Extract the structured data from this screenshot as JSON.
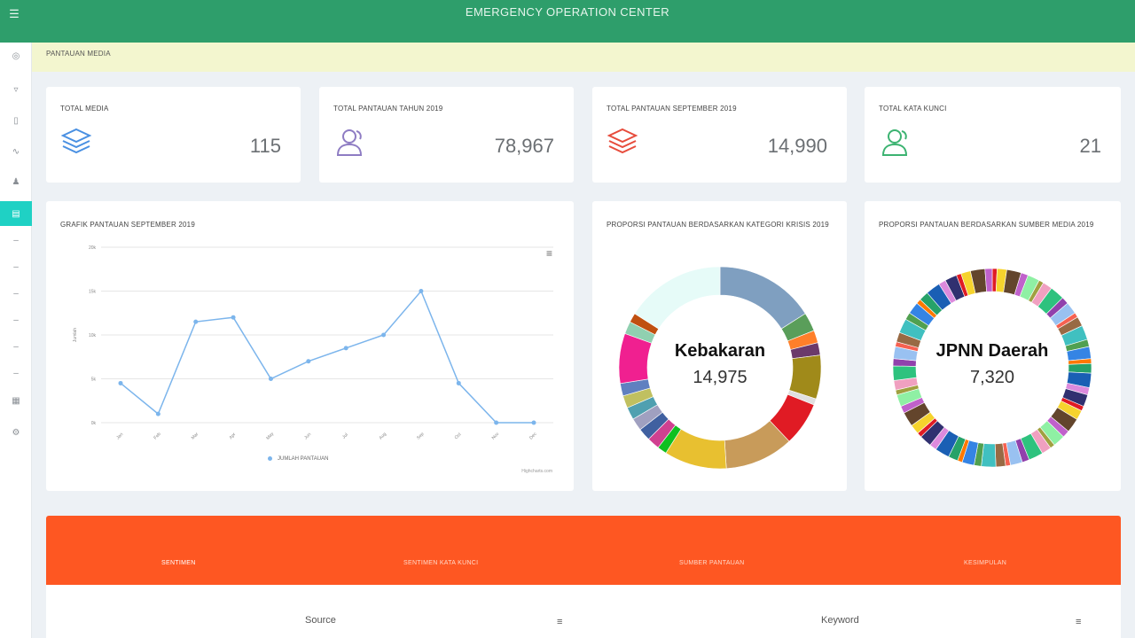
{
  "app": {
    "title": "EMERGENCY OPERATION CENTER"
  },
  "breadcrumb": {
    "text": "PANTAUAN MEDIA"
  },
  "icons": {
    "menu": "hamburger-icon",
    "sidebar": [
      "dashboard-icon",
      "filter-icon",
      "book-icon",
      "chart-icon",
      "user-icon",
      "media-icon",
      "dash-icon",
      "dash-icon",
      "dash-icon",
      "dash-icon",
      "dash-icon",
      "dash-icon",
      "calendar-icon",
      "settings-icon"
    ]
  },
  "colors": {
    "accent": "#2e9e6b",
    "tab_bar": "#fe5722",
    "active_sidebar": "#1fd1c4",
    "crumb_bg": "#f3f6cf",
    "line": "#7cb5ec"
  },
  "stats": [
    {
      "title": "TOTAL MEDIA",
      "value": "115",
      "icon": "layers-icon",
      "color": "#4a90e2"
    },
    {
      "title": "TOTAL PANTAUAN TAHUN 2019",
      "value": "78,967",
      "icon": "users-icon",
      "color": "#8e7cc3"
    },
    {
      "title": "TOTAL PANTAUAN SEPTEMBER 2019",
      "value": "14,990",
      "icon": "layers-icon",
      "color": "#e74c3c"
    },
    {
      "title": "TOTAL KATA KUNCI",
      "value": "21",
      "icon": "users-icon",
      "color": "#3cb371"
    }
  ],
  "line_panel": {
    "title": "GRAFIK PANTAUAN SEPTEMBER 2019",
    "legend": "JUMLAH PANTAUAN",
    "credit": "Highcharts.com"
  },
  "chart_data": {
    "type": "line",
    "x": [
      "Jan",
      "Feb",
      "Mar",
      "Apr",
      "May",
      "Jun",
      "Jul",
      "Aug",
      "Sep",
      "Oct",
      "Nov",
      "Dec"
    ],
    "series": [
      {
        "name": "JUMLAH PANTAUAN",
        "values": [
          4.5,
          1.0,
          11.5,
          12.0,
          5.0,
          7.0,
          8.5,
          10.0,
          15.0,
          4.5,
          0,
          0
        ]
      }
    ],
    "yticks": [
      "20k",
      "15k",
      "10k",
      "5k",
      "0k"
    ],
    "ylim": [
      0,
      20
    ],
    "ylabel": "Jumlah",
    "grid": true,
    "legend": "bottom"
  },
  "donut_kategori": {
    "title": "PROPORSI PANTAUAN BERDASARKAN KATEGORI KRISIS 2019",
    "center_label": "Kebakaran",
    "center_value": "14,975",
    "segments": [
      {
        "value": 16,
        "color": "#7f9fc0"
      },
      {
        "value": 3,
        "color": "#5a9e5a"
      },
      {
        "value": 2,
        "color": "#ff7f2a"
      },
      {
        "value": 2,
        "color": "#6b3a6b"
      },
      {
        "value": 7,
        "color": "#a08a1a"
      },
      {
        "value": 1,
        "color": "#e0e0e0"
      },
      {
        "value": 7,
        "color": "#e01b24"
      },
      {
        "value": 11,
        "color": "#c89b5a"
      },
      {
        "value": 10,
        "color": "#e8c030"
      },
      {
        "value": 1.5,
        "color": "#10c020"
      },
      {
        "value": 2,
        "color": "#d04090"
      },
      {
        "value": 2,
        "color": "#4060a0"
      },
      {
        "value": 2,
        "color": "#a0a0c0"
      },
      {
        "value": 2,
        "color": "#50a0b0"
      },
      {
        "value": 2,
        "color": "#c0c060"
      },
      {
        "value": 2,
        "color": "#6080c0"
      },
      {
        "value": 8,
        "color": "#f02090"
      },
      {
        "value": 2,
        "color": "#90d0b0"
      },
      {
        "value": 1.5,
        "color": "#c05010"
      },
      {
        "value": 16,
        "color": "#e6fbf8"
      }
    ]
  },
  "donut_sumber": {
    "title": "PROPORSI PANTAUAN BERDASARKAN SUMBER MEDIA 2019",
    "center_label": "JPNN Daerah",
    "center_value": "7,320",
    "palette": [
      "#e01b24",
      "#2ec27e",
      "#3584e4",
      "#f6d32d",
      "#9141ac",
      "#ff7800",
      "#63452c",
      "#99c1f1",
      "#26a269",
      "#c061cb",
      "#f66151",
      "#1a5fb4",
      "#8ff0a4",
      "#986a44",
      "#dc8add",
      "#a0a040",
      "#40c0c0",
      "#303070",
      "#f0a0c0",
      "#50a050"
    ],
    "segment_count": 64
  },
  "tabs": [
    {
      "label": "SENTIMEN",
      "active": true
    },
    {
      "label": "SENTIMEN KATA KUNCI",
      "active": false
    },
    {
      "label": "SUMBER PANTAUAN",
      "active": false
    },
    {
      "label": "KESIMPULAN",
      "active": false
    }
  ],
  "bottom": {
    "col1": "Source",
    "col2": "Keyword",
    "menu_icon": "hamburger-icon"
  }
}
